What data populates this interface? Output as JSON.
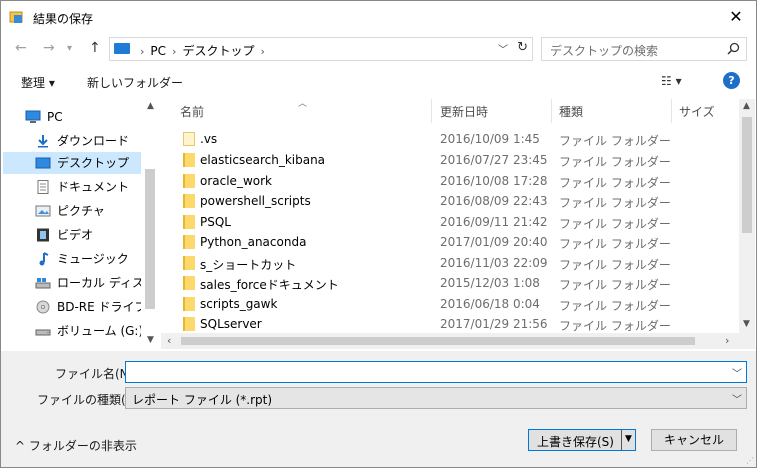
{
  "window": {
    "title": "結果の保存",
    "close_glyph": "✕"
  },
  "nav": {
    "back": "←",
    "forward": "→",
    "up": "↑",
    "breadcrumbs": [
      "PC",
      "デスクトップ"
    ],
    "search_placeholder": "デスクトップの検索"
  },
  "toolbar": {
    "organize": "整理 ▾",
    "new_folder": "新しいフォルダー"
  },
  "sidebar": {
    "items": [
      {
        "label": "PC",
        "icon": "pc-icon",
        "selected": false
      },
      {
        "label": "ダウンロード",
        "icon": "download-icon",
        "selected": false
      },
      {
        "label": "デスクトップ",
        "icon": "desktop-icon",
        "selected": true
      },
      {
        "label": "ドキュメント",
        "icon": "documents-icon",
        "selected": false
      },
      {
        "label": "ピクチャ",
        "icon": "pictures-icon",
        "selected": false
      },
      {
        "label": "ビデオ",
        "icon": "videos-icon",
        "selected": false
      },
      {
        "label": "ミュージック",
        "icon": "music-icon",
        "selected": false
      },
      {
        "label": "ローカル ディスク (C",
        "icon": "local-disk-icon",
        "selected": false
      },
      {
        "label": "BD-RE ドライブ (F:",
        "icon": "disc-drive-icon",
        "selected": false
      },
      {
        "label": "ボリューム (G:)",
        "icon": "volume-drive-icon",
        "selected": false
      }
    ]
  },
  "columns": {
    "name": "名前",
    "date": "更新日時",
    "type": "種類",
    "size": "サイズ"
  },
  "files": [
    {
      "name": ".vs",
      "date": "2016/10/09 1:45",
      "type": "ファイル フォルダー"
    },
    {
      "name": "elasticsearch_kibana",
      "date": "2016/07/27 23:45",
      "type": "ファイル フォルダー"
    },
    {
      "name": "oracle_work",
      "date": "2016/10/08 17:28",
      "type": "ファイル フォルダー"
    },
    {
      "name": "powershell_scripts",
      "date": "2016/08/09 22:43",
      "type": "ファイル フォルダー"
    },
    {
      "name": "PSQL",
      "date": "2016/09/11 21:42",
      "type": "ファイル フォルダー"
    },
    {
      "name": "Python_anaconda",
      "date": "2017/01/09 20:40",
      "type": "ファイル フォルダー"
    },
    {
      "name": "s_ショートカット",
      "date": "2016/11/03 22:09",
      "type": "ファイル フォルダー"
    },
    {
      "name": "sales_forceドキュメント",
      "date": "2015/12/03 1:08",
      "type": "ファイル フォルダー"
    },
    {
      "name": "scripts_gawk",
      "date": "2016/06/18 0:04",
      "type": "ファイル フォルダー"
    },
    {
      "name": "SQLserver",
      "date": "2017/01/29 21:56",
      "type": "ファイル フォルダー"
    }
  ],
  "bottom": {
    "filename_label": "ファイル名(N):",
    "filename_value": "",
    "filetype_label": "ファイルの種類(T):",
    "filetype_value": "レポート ファイル (*.rpt)",
    "hide_folders": "^ フォルダーの非表示",
    "save_label": "上書き保存(S)",
    "cancel_label": "キャンセル"
  }
}
